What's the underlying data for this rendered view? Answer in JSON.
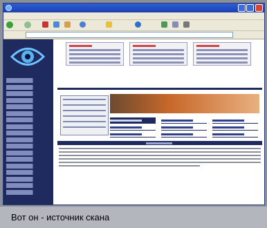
{
  "caption": "Вот он - источник скана",
  "colors": {
    "sidebar": "#1f2a5e",
    "titlebar": "#2f5fd8",
    "caption_bg": "#b3b7bd",
    "banner": "#c8682a"
  },
  "icons": [
    "ie-icon",
    "back-icon",
    "forward-icon",
    "stop-icon",
    "refresh-icon",
    "home-icon",
    "search-icon",
    "favorites-icon",
    "media-icon",
    "history-icon",
    "mail-icon",
    "print-icon",
    "eye-logo-icon"
  ]
}
